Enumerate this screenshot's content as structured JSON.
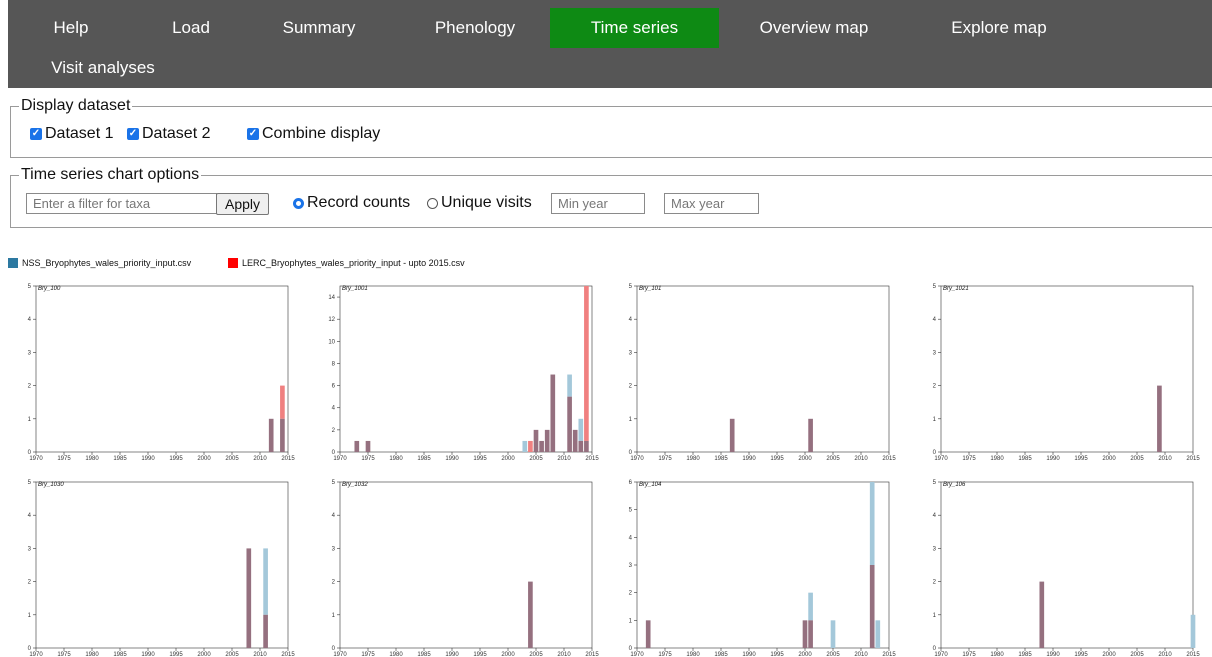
{
  "nav": {
    "tabs": [
      "Help",
      "Load",
      "Summary",
      "Phenology",
      "Time series",
      "Overview map",
      "Explore map",
      "Visit analyses"
    ],
    "active": "Time series"
  },
  "display_dataset": {
    "legend": "Display dataset",
    "options": [
      {
        "label": "Dataset 1",
        "checked": true
      },
      {
        "label": "Dataset 2",
        "checked": true
      },
      {
        "label": "Combine display",
        "checked": true
      }
    ]
  },
  "chart_options": {
    "legend": "Time series chart options",
    "filter_placeholder": "Enter a filter for taxa",
    "apply_label": "Apply",
    "radio": [
      {
        "label": "Record counts",
        "selected": true
      },
      {
        "label": "Unique visits",
        "selected": false
      }
    ],
    "min_year_placeholder": "Min year",
    "max_year_placeholder": "Max year"
  },
  "legend": {
    "series": [
      {
        "name": "NSS_Bryophytes_wales_priority_input.csv",
        "color": "#2c79a1"
      },
      {
        "name": "LERC_Bryophytes_wales_priority_input - upto 2015.csv",
        "color": "#ff0000"
      }
    ]
  },
  "colors": {
    "nss": "#a4c8da",
    "lerc": "#f08080",
    "overlap": "#95707f"
  },
  "chart_data": [
    {
      "type": "bar",
      "title": "Bry_100",
      "ylim": [
        0,
        5
      ],
      "yticks": [
        0,
        1,
        2,
        3,
        4,
        5
      ],
      "xlim": [
        1970,
        2015
      ],
      "xticks": [
        1970,
        1975,
        1980,
        1985,
        1990,
        1995,
        2000,
        2005,
        2010,
        2015
      ],
      "series": [
        {
          "name": "NSS_Bryophytes_wales_priority_input.csv",
          "x": [
            2012,
            2014
          ],
          "values": [
            1,
            1
          ]
        },
        {
          "name": "LERC_Bryophytes_wales_priority_input - upto 2015.csv",
          "x": [
            2012,
            2014
          ],
          "values": [
            1,
            2
          ]
        }
      ]
    },
    {
      "type": "bar",
      "title": "Bry_1001",
      "ylim": [
        0,
        15
      ],
      "yticks": [
        0,
        2,
        4,
        6,
        8,
        10,
        12,
        14
      ],
      "xlim": [
        1970,
        2015
      ],
      "xticks": [
        1970,
        1975,
        1980,
        1985,
        1990,
        1995,
        2000,
        2005,
        2010,
        2015
      ],
      "series": [
        {
          "name": "NSS_Bryophytes_wales_priority_input.csv",
          "x": [
            1973,
            1975,
            2003,
            2005,
            2006,
            2007,
            2008,
            2011,
            2012,
            2013,
            2014
          ],
          "values": [
            1,
            1,
            1,
            2,
            1,
            2,
            7,
            7,
            2,
            3,
            1
          ]
        },
        {
          "name": "LERC_Bryophytes_wales_priority_input - upto 2015.csv",
          "x": [
            1973,
            1975,
            2004,
            2005,
            2006,
            2007,
            2008,
            2011,
            2012,
            2013,
            2014
          ],
          "values": [
            1,
            1,
            1,
            2,
            1,
            2,
            7,
            5,
            2,
            1,
            15
          ]
        }
      ]
    },
    {
      "type": "bar",
      "title": "Bry_101",
      "ylim": [
        0,
        5
      ],
      "yticks": [
        0,
        1,
        2,
        3,
        4,
        5
      ],
      "xlim": [
        1970,
        2015
      ],
      "xticks": [
        1970,
        1975,
        1980,
        1985,
        1990,
        1995,
        2000,
        2005,
        2010,
        2015
      ],
      "series": [
        {
          "name": "NSS_Bryophytes_wales_priority_input.csv",
          "x": [
            1987,
            2001
          ],
          "values": [
            1,
            1
          ]
        },
        {
          "name": "LERC_Bryophytes_wales_priority_input - upto 2015.csv",
          "x": [
            1987,
            2001
          ],
          "values": [
            1,
            1
          ]
        }
      ]
    },
    {
      "type": "bar",
      "title": "Bry_1021",
      "ylim": [
        0,
        5
      ],
      "yticks": [
        0,
        1,
        2,
        3,
        4,
        5
      ],
      "xlim": [
        1970,
        2015
      ],
      "xticks": [
        1970,
        1975,
        1980,
        1985,
        1990,
        1995,
        2000,
        2005,
        2010,
        2015
      ],
      "series": [
        {
          "name": "NSS_Bryophytes_wales_priority_input.csv",
          "x": [
            2009
          ],
          "values": [
            2
          ]
        },
        {
          "name": "LERC_Bryophytes_wales_priority_input - upto 2015.csv",
          "x": [
            2009
          ],
          "values": [
            2
          ]
        }
      ]
    },
    {
      "type": "bar",
      "title": "Bry_1030",
      "ylim": [
        0,
        5
      ],
      "yticks": [
        0,
        1,
        2,
        3,
        4,
        5
      ],
      "xlim": [
        1970,
        2015
      ],
      "xticks": [
        1970,
        1975,
        1980,
        1985,
        1990,
        1995,
        2000,
        2005,
        2010,
        2015
      ],
      "series": [
        {
          "name": "NSS_Bryophytes_wales_priority_input.csv",
          "x": [
            2008,
            2011
          ],
          "values": [
            3,
            3
          ]
        },
        {
          "name": "LERC_Bryophytes_wales_priority_input - upto 2015.csv",
          "x": [
            2008,
            2011
          ],
          "values": [
            3,
            1
          ]
        }
      ]
    },
    {
      "type": "bar",
      "title": "Bry_1032",
      "ylim": [
        0,
        5
      ],
      "yticks": [
        0,
        1,
        2,
        3,
        4,
        5
      ],
      "xlim": [
        1970,
        2015
      ],
      "xticks": [
        1970,
        1975,
        1980,
        1985,
        1990,
        1995,
        2000,
        2005,
        2010,
        2015
      ],
      "series": [
        {
          "name": "NSS_Bryophytes_wales_priority_input.csv",
          "x": [
            2004
          ],
          "values": [
            2
          ]
        },
        {
          "name": "LERC_Bryophytes_wales_priority_input - upto 2015.csv",
          "x": [
            2004
          ],
          "values": [
            2
          ]
        }
      ]
    },
    {
      "type": "bar",
      "title": "Bry_104",
      "ylim": [
        0,
        6
      ],
      "yticks": [
        0,
        1,
        2,
        3,
        4,
        5,
        6
      ],
      "xlim": [
        1970,
        2015
      ],
      "xticks": [
        1970,
        1975,
        1980,
        1985,
        1990,
        1995,
        2000,
        2005,
        2010,
        2015
      ],
      "series": [
        {
          "name": "NSS_Bryophytes_wales_priority_input.csv",
          "x": [
            1972,
            2000,
            2001,
            2005,
            2012,
            2013
          ],
          "values": [
            1,
            1,
            2,
            1,
            6,
            1
          ]
        },
        {
          "name": "LERC_Bryophytes_wales_priority_input - upto 2015.csv",
          "x": [
            1972,
            2000,
            2001,
            2012
          ],
          "values": [
            1,
            1,
            1,
            3
          ]
        }
      ]
    },
    {
      "type": "bar",
      "title": "Bry_106",
      "ylim": [
        0,
        5
      ],
      "yticks": [
        0,
        1,
        2,
        3,
        4,
        5
      ],
      "xlim": [
        1970,
        2015
      ],
      "xticks": [
        1970,
        1975,
        1980,
        1985,
        1990,
        1995,
        2000,
        2005,
        2010,
        2015
      ],
      "series": [
        {
          "name": "NSS_Bryophytes_wales_priority_input.csv",
          "x": [
            1988,
            2015
          ],
          "values": [
            2,
            1
          ]
        },
        {
          "name": "LERC_Bryophytes_wales_priority_input - upto 2015.csv",
          "x": [
            1988
          ],
          "values": [
            2
          ]
        }
      ]
    }
  ]
}
